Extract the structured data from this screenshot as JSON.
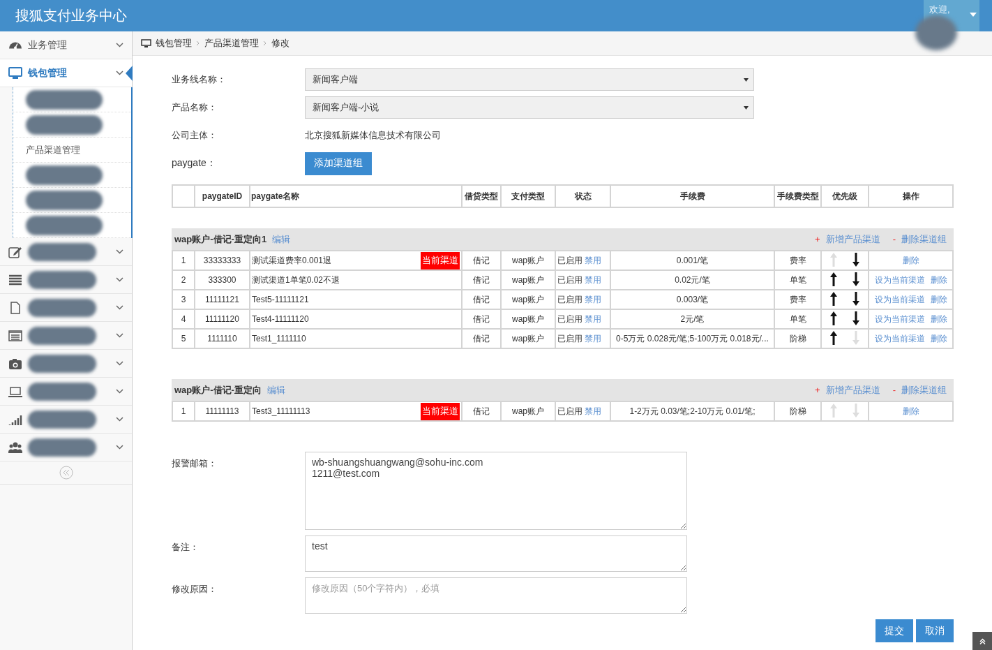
{
  "header": {
    "title": "搜狐支付业务中心",
    "welcome": "欢迎,"
  },
  "sidebar": {
    "items": [
      {
        "label": "业务管理",
        "active": false,
        "redacted": false
      },
      {
        "label": "钱包管理",
        "active": true,
        "redacted": false,
        "children": [
          {
            "redacted": true
          },
          {
            "redacted": true
          },
          {
            "label": "产品渠道管理",
            "redacted": false
          },
          {
            "redacted": true
          },
          {
            "redacted": true
          },
          {
            "redacted": true
          }
        ]
      },
      {
        "active": false,
        "redacted": true
      },
      {
        "active": false,
        "redacted": true
      },
      {
        "active": false,
        "redacted": true
      },
      {
        "active": false,
        "redacted": true
      },
      {
        "active": false,
        "redacted": true
      },
      {
        "active": false,
        "redacted": true
      },
      {
        "active": false,
        "redacted": true
      },
      {
        "active": false,
        "redacted": true
      }
    ]
  },
  "breadcrumb": [
    "钱包管理",
    "产品渠道管理",
    "修改"
  ],
  "form": {
    "business_line": {
      "label": "业务线名称：",
      "value": "新闻客户端"
    },
    "product": {
      "label": "产品名称：",
      "value": "新闻客户端-小说"
    },
    "company": {
      "label": "公司主体：",
      "value": "北京搜狐新媒体信息技术有限公司"
    },
    "paygate": {
      "label": "paygate：",
      "button": "添加渠道组"
    }
  },
  "table": {
    "columns": [
      "",
      "paygateID",
      "paygate名称",
      "借贷类型",
      "支付类型",
      "状态",
      "手续费",
      "手续费类型",
      "优先级",
      "操作"
    ],
    "groups": [
      {
        "name": "wap账户-借记-重定向1",
        "edit": "编辑",
        "add_mark": "+",
        "add": "新增产品渠道",
        "remove_mark": "-",
        "remove": "删除渠道组",
        "rows": [
          {
            "no": "1",
            "id": "33333333",
            "name": "测试渠道费率0.001退",
            "badge": "当前渠道",
            "credit": "借记",
            "pay": "wap账户",
            "status": "已启用",
            "toggle": "禁用",
            "fee": "0.001/笔",
            "fee_type": "费率",
            "up_enabled": false,
            "down_enabled": true,
            "actions": [
              "删除"
            ]
          },
          {
            "no": "2",
            "id": "333300",
            "name": "测试渠道1单笔0.02不退",
            "credit": "借记",
            "pay": "wap账户",
            "status": "已启用",
            "toggle": "禁用",
            "fee": "0.02元/笔",
            "fee_type": "单笔",
            "up_enabled": true,
            "down_enabled": true,
            "actions": [
              "设为当前渠道",
              "删除"
            ]
          },
          {
            "no": "3",
            "id": "11111121",
            "name": "Test5-11111121",
            "credit": "借记",
            "pay": "wap账户",
            "status": "已启用",
            "toggle": "禁用",
            "fee": "0.003/笔",
            "fee_type": "费率",
            "up_enabled": true,
            "down_enabled": true,
            "actions": [
              "设为当前渠道",
              "删除"
            ]
          },
          {
            "no": "4",
            "id": "11111120",
            "name": "Test4-11111120",
            "credit": "借记",
            "pay": "wap账户",
            "status": "已启用",
            "toggle": "禁用",
            "fee": "2元/笔",
            "fee_type": "单笔",
            "up_enabled": true,
            "down_enabled": true,
            "actions": [
              "设为当前渠道",
              "删除"
            ]
          },
          {
            "no": "5",
            "id": "1111110",
            "name": "Test1_1111110",
            "credit": "借记",
            "pay": "wap账户",
            "status": "已启用",
            "toggle": "禁用",
            "fee": "0-5万元 0.028元/笔;5-100万元 0.018元/...",
            "fee_type": "阶梯",
            "up_enabled": true,
            "down_enabled": false,
            "actions": [
              "设为当前渠道",
              "删除"
            ]
          }
        ]
      },
      {
        "name": "wap账户-借记-重定向",
        "edit": "编辑",
        "add_mark": "+",
        "add": "新增产品渠道",
        "remove_mark": "-",
        "remove": "删除渠道组",
        "rows": [
          {
            "no": "1",
            "id": "11111113",
            "name": "Test3_11111113",
            "badge": "当前渠道",
            "credit": "借记",
            "pay": "wap账户",
            "status": "已启用",
            "toggle": "禁用",
            "fee": "1-2万元 0.03/笔;2-10万元 0.01/笔;",
            "fee_type": "阶梯",
            "up_enabled": false,
            "down_enabled": false,
            "actions": [
              "删除"
            ]
          }
        ]
      }
    ]
  },
  "alert_email": {
    "label": "报警邮箱：",
    "value": "wb-shuangshuangwang@sohu-inc.com\n1211@test.com"
  },
  "remark": {
    "label": "备注：",
    "value": "test"
  },
  "reason": {
    "label": "修改原因：",
    "placeholder": "修改原因（50个字符内），必填"
  },
  "buttons": [
    "提交",
    "取消"
  ]
}
